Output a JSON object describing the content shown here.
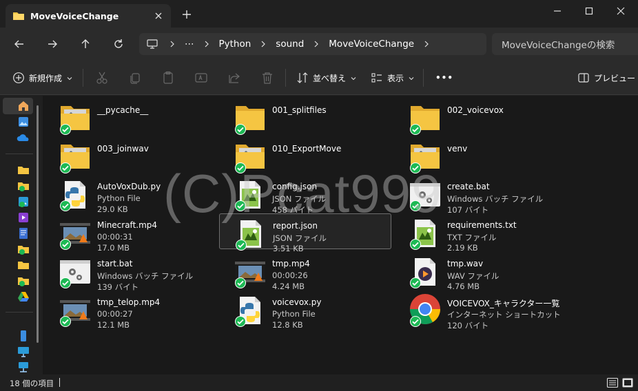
{
  "window": {
    "tab_title": "MoveVoiceChange",
    "icons": [
      "folder-icon",
      "close-icon",
      "plus-icon",
      "minimize-icon",
      "maximize-icon",
      "window-close-icon"
    ]
  },
  "address": {
    "breadcrumbs": [
      "Python",
      "sound",
      "MoveVoiceChange"
    ],
    "overflow": "⋯",
    "search_placeholder": "MoveVoiceChangeの検索"
  },
  "commands": {
    "new_label": "新規作成",
    "sort_label": "並べ替え",
    "view_label": "表示",
    "more_label": "•••",
    "preview_label": "プレビュー"
  },
  "items": [
    {
      "name": "__pycache__",
      "line1": "",
      "line2": "",
      "icon": "folder-thumb-icon"
    },
    {
      "name": "001_splitfiles",
      "line1": "",
      "line2": "",
      "icon": "folder-icon"
    },
    {
      "name": "002_voicevox",
      "line1": "",
      "line2": "",
      "icon": "folder-icon"
    },
    {
      "name": "003_joinwav",
      "line1": "",
      "line2": "",
      "icon": "folder-thumb-icon"
    },
    {
      "name": "010_ExportMove",
      "line1": "",
      "line2": "",
      "icon": "folder-thumb-icon"
    },
    {
      "name": "venv",
      "line1": "",
      "line2": "",
      "icon": "folder-thumb-icon"
    },
    {
      "name": "AutoVoxDub.py",
      "line1": "Python File",
      "line2": "29.0 KB",
      "icon": "python-file-icon"
    },
    {
      "name": "config.json",
      "line1": "JSON ファイル",
      "line2": "458 バイト",
      "icon": "json-file-icon"
    },
    {
      "name": "create.bat",
      "line1": "Windows バッチ ファイル",
      "line2": "107 バイト",
      "icon": "batch-file-icon"
    },
    {
      "name": "Minecraft.mp4",
      "line1": "00:00:31",
      "line2": "17.0 MB",
      "icon": "video-file-icon"
    },
    {
      "name": "report.json",
      "line1": "JSON ファイル",
      "line2": "3.51 KB",
      "icon": "json-file-icon"
    },
    {
      "name": "requirements.txt",
      "line1": "TXT ファイル",
      "line2": "2.19 KB",
      "icon": "text-file-icon"
    },
    {
      "name": "start.bat",
      "line1": "Windows バッチ ファイル",
      "line2": "139 バイト",
      "icon": "batch-file-icon"
    },
    {
      "name": "tmp.mp4",
      "line1": "00:00:26",
      "line2": "4.24 MB",
      "icon": "video-file-icon"
    },
    {
      "name": "tmp.wav",
      "line1": "WAV ファイル",
      "line2": "4.76 MB",
      "icon": "audio-file-icon"
    },
    {
      "name": "tmp_telop.mp4",
      "line1": "00:00:27",
      "line2": "12.1 MB",
      "icon": "video-file-icon"
    },
    {
      "name": "voicevox.py",
      "line1": "Python File",
      "line2": "12.8 KB",
      "icon": "python-file-icon"
    },
    {
      "name": "VOICEVOX_キャラクター一覧",
      "line1": "インターネット ショートカット",
      "line2": "120 バイト",
      "icon": "chrome-shortcut-icon"
    }
  ],
  "selected_item": "report.json",
  "watermark": "(C)Pcat999",
  "status": {
    "count_text": "18 個の項目"
  },
  "colors": {
    "folder": "#f5c542",
    "check": "#1db954",
    "accent": "#60cdff"
  }
}
